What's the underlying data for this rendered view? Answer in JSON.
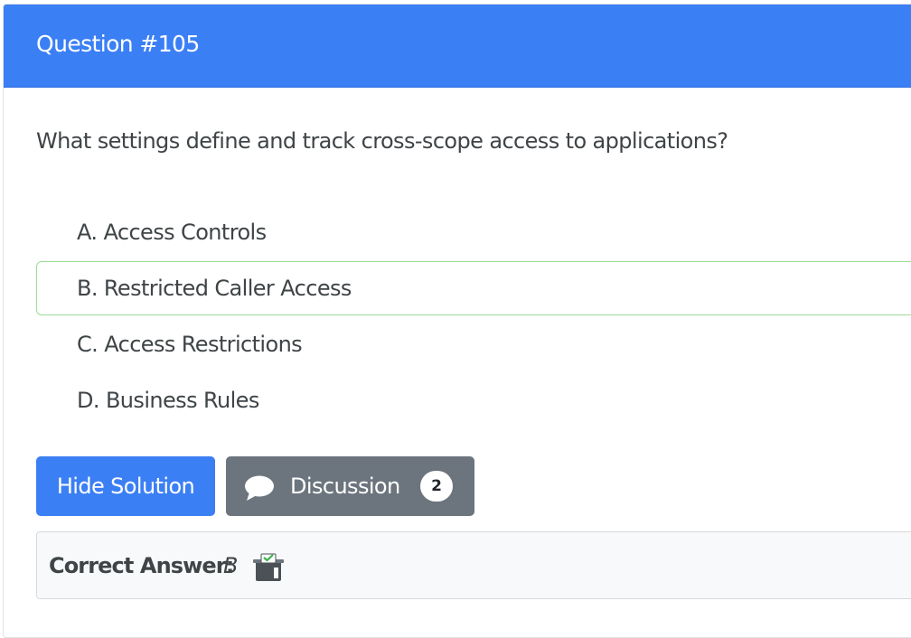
{
  "header": {
    "title": "Question #105"
  },
  "question": {
    "text": "What settings define and track cross-scope access to applications?"
  },
  "choices": [
    {
      "text": "A. Access Controls"
    },
    {
      "text": "B. Restricted Caller Access"
    },
    {
      "text": "C. Access Restrictions"
    },
    {
      "text": "D. Business Rules"
    }
  ],
  "buttons": {
    "hide_solution": "Hide Solution",
    "discussion": "Discussion",
    "discussion_count": "2"
  },
  "answer": {
    "label": "Correct Answer:",
    "value": "B"
  },
  "icons": {
    "discussion": "chat-bubble-icon",
    "vote": "ballot-box-check-icon"
  },
  "colors": {
    "primary": "#3b7ff5",
    "secondary": "#6c757d",
    "correct_border": "#9bdc97"
  }
}
